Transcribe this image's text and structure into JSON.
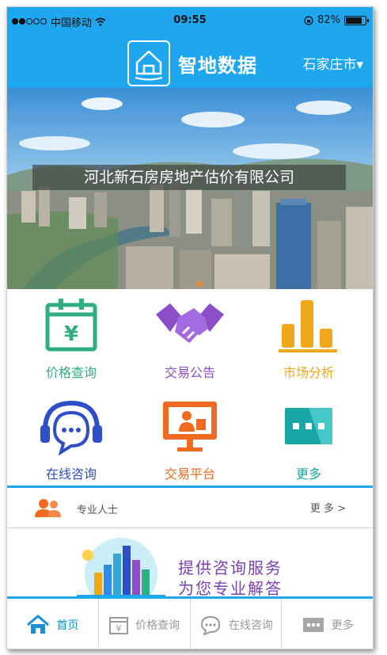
{
  "status_bar": {
    "carrier": "中国移动",
    "time": "09:55",
    "battery": "82%"
  },
  "header": {
    "title": "智地数据",
    "city": "石家庄市▾"
  },
  "banner": {
    "caption": "河北新石房房地产估价有限公司",
    "active_dot": 1
  },
  "menu": [
    {
      "label": "价格查询",
      "icon": "calendar-yen-icon",
      "color": "#2fae84"
    },
    {
      "label": "交易公告",
      "icon": "handshake-icon",
      "color": "#8b4ec8"
    },
    {
      "label": "市场分析",
      "icon": "bar-chart-icon",
      "color": "#f0a81a"
    },
    {
      "label": "在线咨询",
      "icon": "headset-chat-icon",
      "color": "#2e4fc7"
    },
    {
      "label": "交易平台",
      "icon": "monitor-presenter-icon",
      "color": "#f26a1f"
    },
    {
      "label": "更多",
      "icon": "more-dots-icon",
      "color": "#1aa6a6"
    }
  ],
  "professionals": {
    "label": "专业人士",
    "more": "更 多 >"
  },
  "promo": {
    "line1": "提供咨询服务",
    "line2": "为您专业解答"
  },
  "tabs": [
    {
      "label": "首页",
      "icon": "home-icon",
      "active": true
    },
    {
      "label": "价格查询",
      "icon": "calendar-yen-icon",
      "active": false
    },
    {
      "label": "在线咨询",
      "icon": "chat-icon",
      "active": false
    },
    {
      "label": "更多",
      "icon": "more-dots-icon",
      "active": false
    }
  ]
}
